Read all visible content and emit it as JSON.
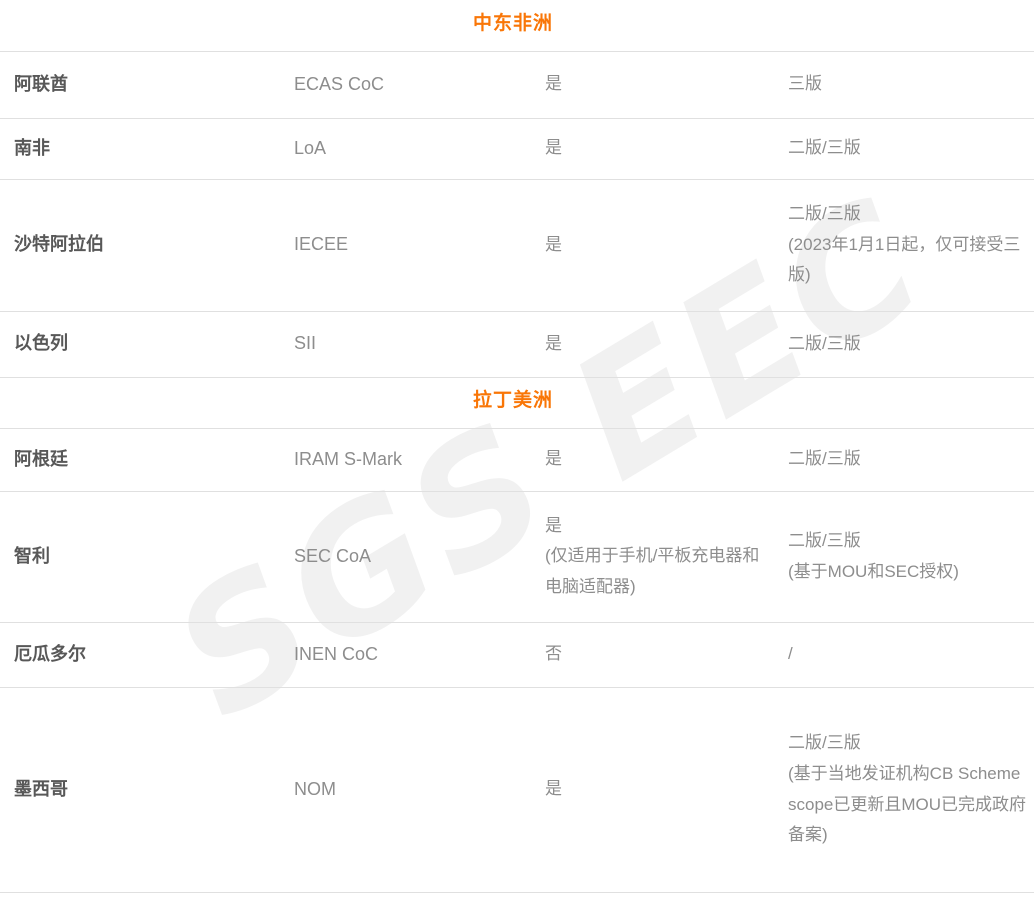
{
  "meta": {
    "watermark_text": "SGS EEC",
    "accent_color": "#f97607",
    "country_text_color": "#585858",
    "body_text_color": "#8d8d8d",
    "border_color": "#e0e0e0",
    "watermark_color": "#f1f1f1"
  },
  "table": {
    "sections": [
      {
        "title": "中东非洲",
        "rows": [
          {
            "key": "uae",
            "country": "阿联酋",
            "scheme": "ECAS CoC",
            "accept_lines": [
              "是"
            ],
            "edition_lines": [
              "三版"
            ]
          },
          {
            "key": "za",
            "country": "南非",
            "scheme": "LoA",
            "accept_lines": [
              "是"
            ],
            "edition_lines": [
              "二版/三版"
            ]
          },
          {
            "key": "sa",
            "country": "沙特阿拉伯",
            "scheme": "IECEE",
            "accept_lines": [
              "是"
            ],
            "edition_lines": [
              "二版/三版",
              "(2023年1月1日起，仅可接受三版)"
            ]
          },
          {
            "key": "il",
            "country": "以色列",
            "scheme": "SII",
            "accept_lines": [
              "是"
            ],
            "edition_lines": [
              "二版/三版"
            ]
          }
        ]
      },
      {
        "title": "拉丁美洲",
        "rows": [
          {
            "key": "ar",
            "country": "阿根廷",
            "scheme": "IRAM S-Mark",
            "accept_lines": [
              "是"
            ],
            "edition_lines": [
              "二版/三版"
            ]
          },
          {
            "key": "cl",
            "country": "智利",
            "scheme": "SEC CoA",
            "accept_lines": [
              "是",
              "(仅适用于手机/平板充电器和电脑适配器)"
            ],
            "edition_lines": [
              "二版/三版",
              "(基于MOU和SEC授权)"
            ]
          },
          {
            "key": "ec",
            "country": "厄瓜多尔",
            "scheme": "INEN CoC",
            "accept_lines": [
              "否"
            ],
            "edition_lines": [
              "/"
            ]
          },
          {
            "key": "mx",
            "country": "墨西哥",
            "scheme": "NOM",
            "accept_lines": [
              "是"
            ],
            "edition_lines": [
              "二版/三版",
              "(基于当地发证机构CB Scheme scope已更新且MOU已完成政府备案)"
            ]
          }
        ]
      }
    ]
  }
}
